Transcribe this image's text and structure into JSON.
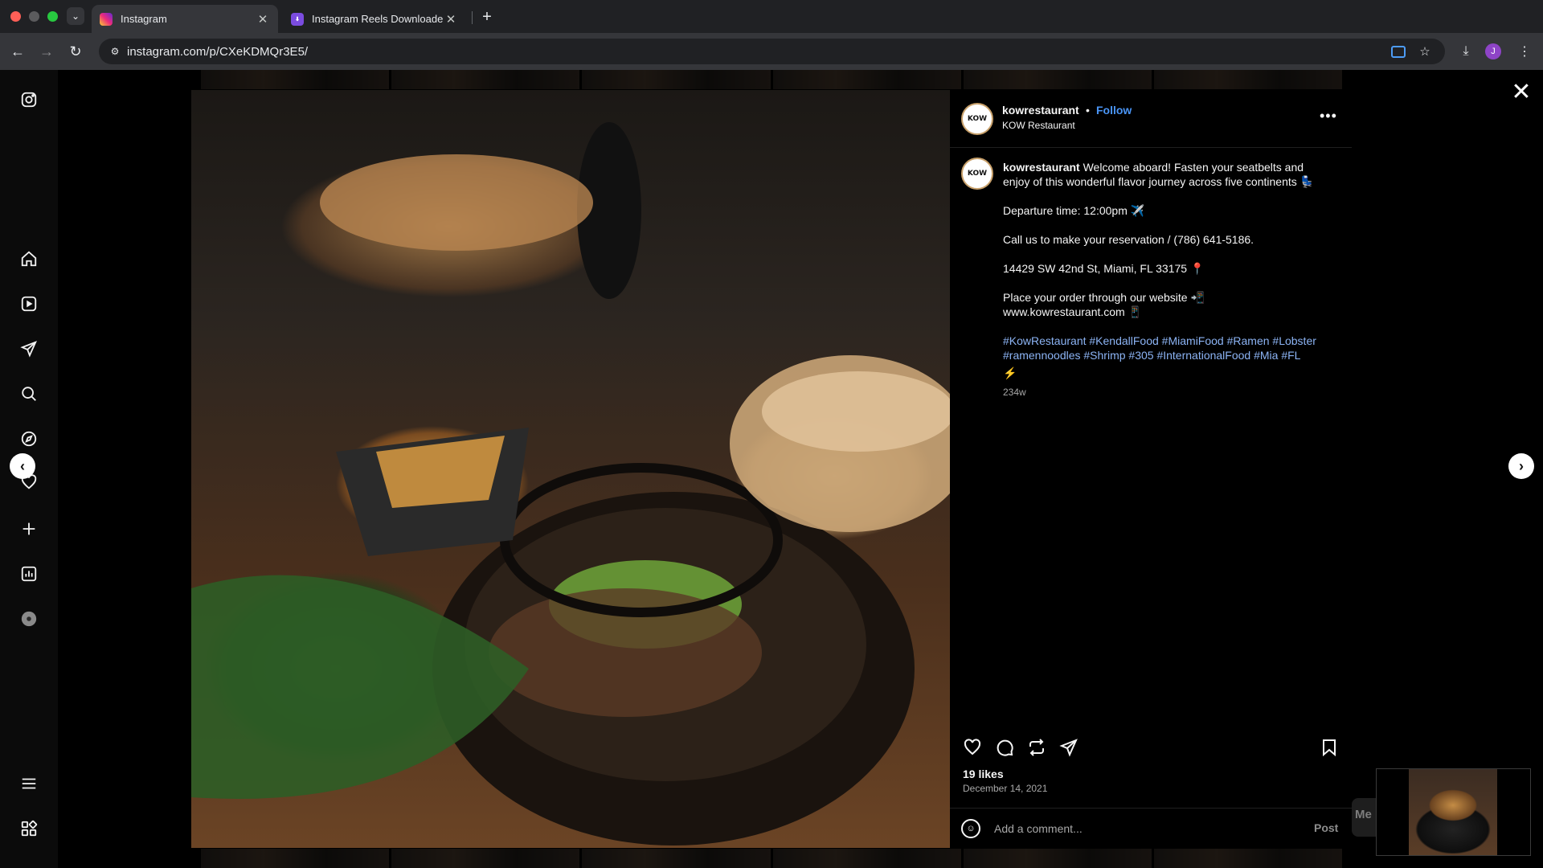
{
  "browser": {
    "tabs": [
      {
        "title": "Instagram",
        "active": true
      },
      {
        "title": "Instagram Reels Downloader",
        "active": false
      }
    ],
    "url": "instagram.com/p/CXeKDMQr3E5/",
    "profile_initial": "J",
    "icons": [
      "tab-search-icon",
      "close-icon",
      "plus-icon",
      "back-icon",
      "forward-icon",
      "reload-icon",
      "site-info-icon",
      "cast-icon",
      "star-icon",
      "download-icon",
      "kebab-menu-icon"
    ],
    "colors": {
      "chrome_bg": "#202124",
      "toolbar_bg": "#35363a",
      "profile": "#8e44c7"
    }
  },
  "sidebar": {
    "icons": [
      "instagram-logo-icon",
      "home-icon",
      "reels-icon",
      "messages-icon",
      "search-icon",
      "explore-icon",
      "notifications-icon",
      "create-icon",
      "dashboard-icon",
      "profile-icon",
      "menu-icon",
      "apps-icon"
    ]
  },
  "post": {
    "username": "kowrestaurant",
    "follow_label": "Follow",
    "location": "KOW Restaurant",
    "avatar_text": "KOW",
    "caption": {
      "username": "kowrestaurant",
      "intro": "Welcome aboard! Fasten your seatbelts and enjoy of this wonderful flavor journey across five continents 💺",
      "departure": "Departure time: 12:00pm ✈️",
      "call": "Call us to make your reservation / (786) 641-5186.",
      "address": "14429 SW 42nd St, Miami, FL 33175 📍",
      "order": "Place your order through our website 📲 www.kowrestaurant.com 📱",
      "hashtags": "#KowRestaurant #KendallFood #MiamiFood #Ramen #Lobster #ramennoodles #Shrimp #305 #InternationalFood #Mia #FL",
      "emoji_line": "⚡",
      "time_ago": "234w"
    },
    "likes": "19 likes",
    "date": "December 14, 2021",
    "comment_placeholder": "Add a comment...",
    "post_label": "Post",
    "colors": {
      "link": "#4a95f6",
      "hashtag": "#8cb4f5",
      "muted": "#a8a8a8"
    }
  },
  "floating": {
    "messages_peek": "Me"
  }
}
